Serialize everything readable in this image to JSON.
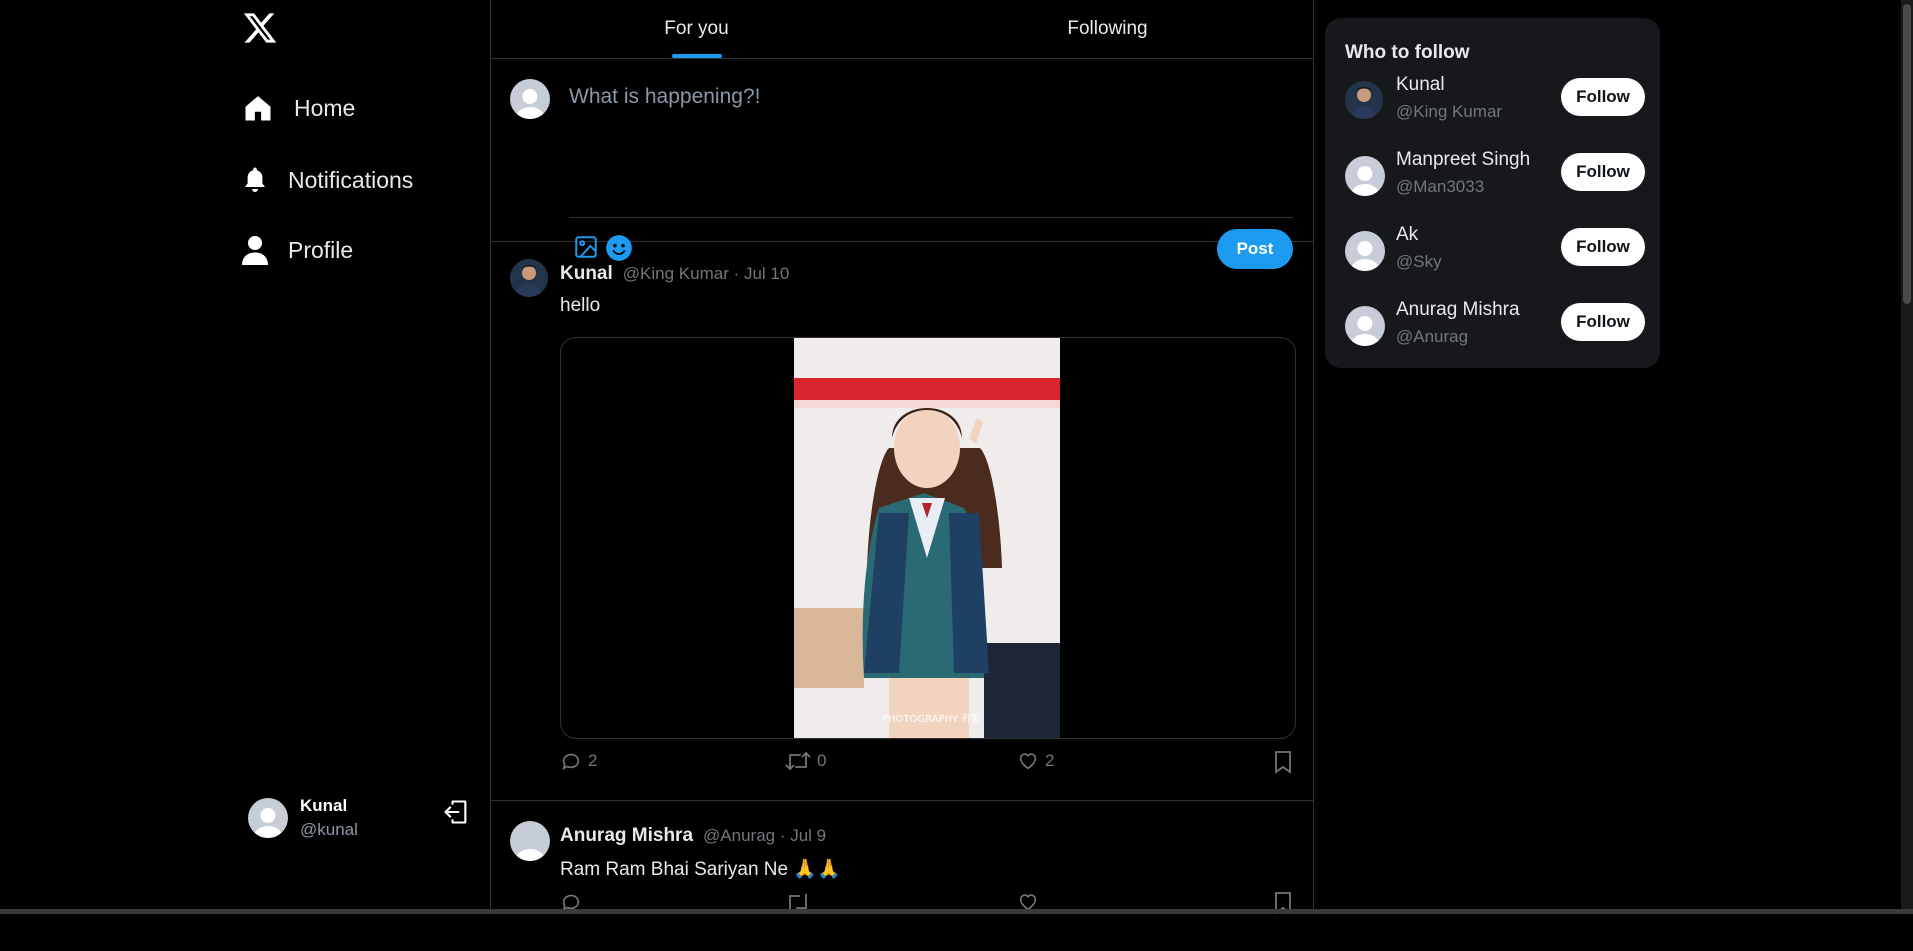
{
  "app": {
    "logo_icon": "x-logo-icon"
  },
  "nav": [
    {
      "label": "Home",
      "icon": "home-icon"
    },
    {
      "label": "Notifications",
      "icon": "bell-icon"
    },
    {
      "label": "Profile",
      "icon": "user-icon"
    }
  ],
  "current_user": {
    "name": "Kunal",
    "handle": "@kunal",
    "logout_icon": "logout-icon"
  },
  "tabs": [
    {
      "label": "For you",
      "active": true
    },
    {
      "label": "Following",
      "active": false
    }
  ],
  "composer": {
    "placeholder": "What is happening?!",
    "tools": [
      "image-icon",
      "emoji-icon"
    ],
    "post_label": "Post"
  },
  "tweets": [
    {
      "name": "Kunal",
      "meta": "@King Kumar · Jul 10",
      "text": "hello",
      "photo_caption": "PHOTOGRAPHY 키함",
      "replies": "2",
      "retweets": "0",
      "likes": "2"
    },
    {
      "name": "Anurag Mishra",
      "meta": "@Anurag · Jul 9",
      "text": "Ram Ram Bhai Sariyan Ne 🙏🙏"
    }
  ],
  "who_to_follow": {
    "title": "Who to follow",
    "users": [
      {
        "name": "Kunal",
        "handle": "@King Kumar",
        "button": "Follow"
      },
      {
        "name": "Manpreet Singh",
        "handle": "@Man3033",
        "button": "Follow"
      },
      {
        "name": "Ak",
        "handle": "@Sky",
        "button": "Follow"
      },
      {
        "name": "Anurag Mishra",
        "handle": "@Anurag",
        "button": "Follow"
      }
    ]
  },
  "colors": {
    "accent": "#1d9bf0",
    "background": "#000000",
    "card": "#16181c",
    "muted": "#71767b"
  }
}
